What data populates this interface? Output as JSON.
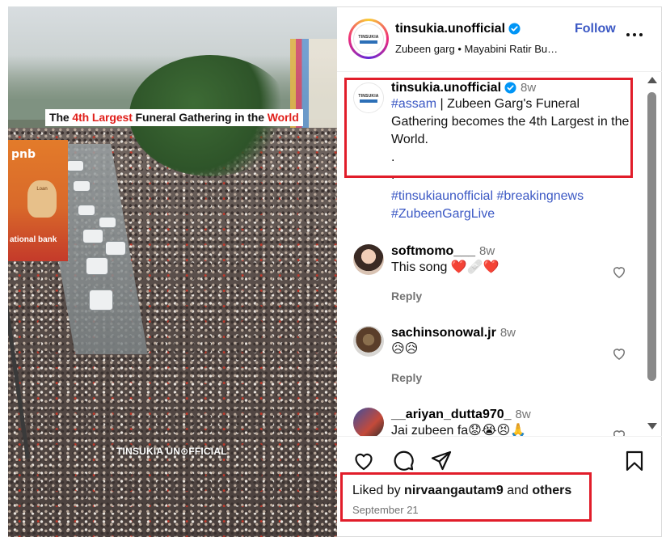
{
  "media": {
    "headline_prefix": "The ",
    "headline_red1": "4th Largest",
    "headline_mid": " Funeral Gathering in the ",
    "headline_red2": "World",
    "watermark": "TINSUKIA UN⊙FFICIAL",
    "billboard_brand": "pnb",
    "billboard_bank": "ational bank"
  },
  "header": {
    "username": "tinsukia.unofficial",
    "follow_label": "Follow",
    "subtitle": "Zubeen garg • Mayabini Ratir Bu…",
    "more_icon": "more-horizontal-icon"
  },
  "logo": {
    "line1": "TINSUKIA"
  },
  "caption": {
    "username": "tinsukia.unofficial",
    "time": "8w",
    "hashtag_lead": "#assam",
    "text": " | Zubeen Garg's Funeral Gathering becomes the 4th Largest in the World.",
    "dot1": ".",
    "dot2": ".",
    "hashtags_line1": "#tinsukiaunofficial #breakingnews",
    "hashtags_line2": "#ZubeenGargLive"
  },
  "comments": [
    {
      "username": "softmomo___",
      "time": "8w",
      "text": "This song ❤️🩹❤️",
      "reply": "Reply"
    },
    {
      "username": "sachinsonowal.jr",
      "time": "8w",
      "text": "😥😥",
      "reply": "Reply"
    },
    {
      "username": "__ariyan_dutta970_",
      "time": "8w",
      "text": "Jai zubeen fa😟😭😣🙏"
    }
  ],
  "likes": {
    "prefix": "Liked by ",
    "user": "nirvaangautam9",
    "and": " and ",
    "others": "others",
    "date": "September 21"
  },
  "colors": {
    "link": "#3b58c4",
    "annotation_red": "#e11d2a",
    "headline_red": "#e0201b",
    "muted": "#737373"
  }
}
